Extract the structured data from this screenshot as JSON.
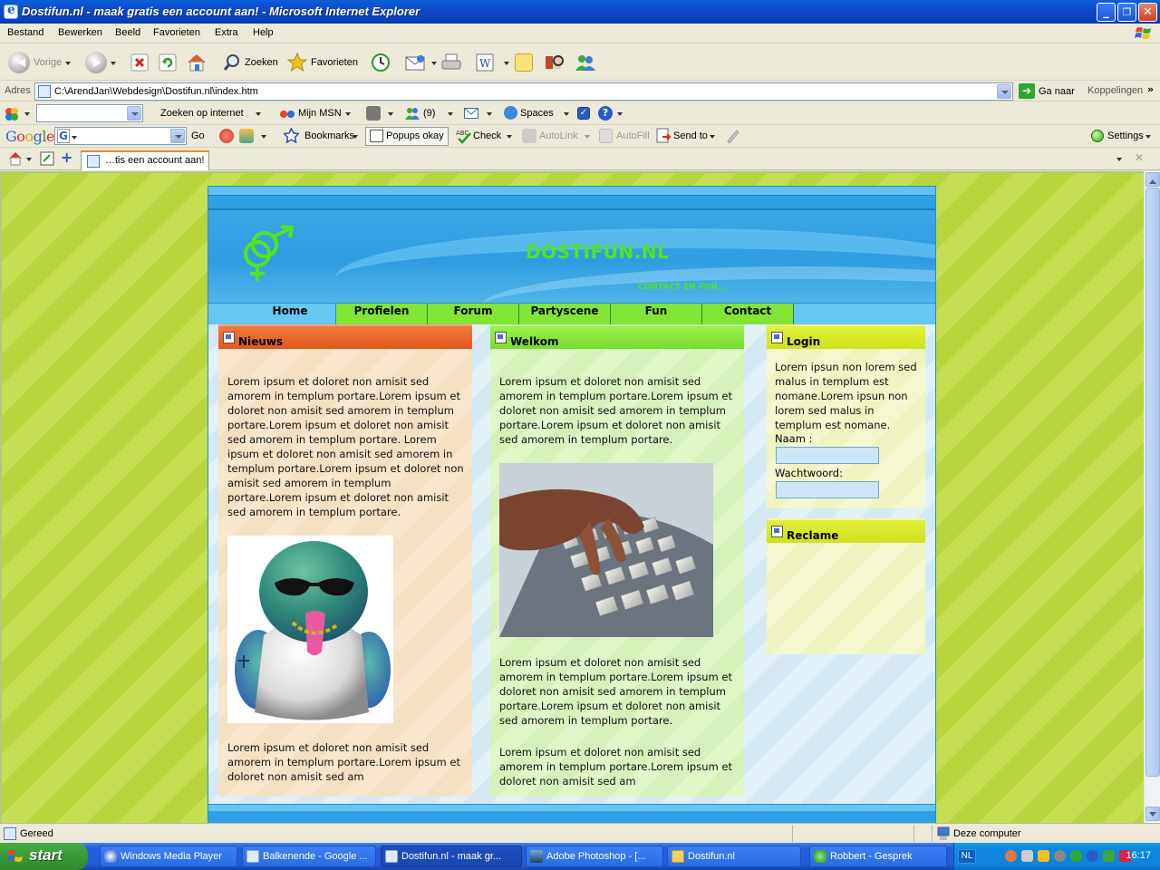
{
  "window": {
    "title": "Dostifun.nl - maak gratis een account aan! - Microsoft Internet Explorer",
    "minimize": "_",
    "maximize": "❐",
    "close": "✕"
  },
  "menu": [
    "Bestand",
    "Bewerken",
    "Beeld",
    "Favorieten",
    "Extra",
    "Help"
  ],
  "toolbar": {
    "back_label": "Vorige",
    "search_label": "Zoeken",
    "favorites_label": "Favorieten"
  },
  "address": {
    "label": "Adres",
    "url": "C:\\ArendJan\\Webdesign\\Dostifun.nl\\index.htm",
    "go_label": "Ga naar",
    "links_label": "Koppelingen"
  },
  "msn_toolbar": {
    "search_value": "",
    "search_web_label": "Zoeken op internet",
    "my_msn_label": "Mijn MSN",
    "messenger_count": "(9)",
    "spaces_label": "Spaces"
  },
  "google_toolbar": {
    "logo_letters": [
      "G",
      "o",
      "o",
      "g",
      "l",
      "e"
    ],
    "search_value": "",
    "go_label": "Go",
    "bookmarks_label": "Bookmarks",
    "popups_label": "Popups okay",
    "check_label": "Check",
    "autolink_label": "AutoLink",
    "autofill_label": "AutoFill",
    "sendto_label": "Send to",
    "settings_label": "Settings"
  },
  "tabs": [
    {
      "label": "…tis een account aan!",
      "active": true
    }
  ],
  "site": {
    "title": "DOSTIFUN.NL",
    "slogan": "CONTACT EN FUN....",
    "nav": [
      "Home",
      "Profielen",
      "Forum",
      "Partyscene",
      "Fun",
      "Contact"
    ],
    "news": {
      "heading": "Nieuws",
      "text1": "Lorem ipsum et doloret non amisit sed amorem in templum portare.Lorem ipsum et doloret non amisit sed amorem in templum portare.Lorem ipsum et doloret non amisit sed amorem in templum portare. Lorem ipsum et doloret non amisit sed amorem in templum portare.Lorem ipsum et doloret non amisit sed amorem in templum portare.Lorem ipsum et doloret non amisit sed amorem in templum portare.",
      "text2": "Lorem ipsum et doloret non amisit sed amorem in templum portare.Lorem ipsum et doloret non amisit sed am"
    },
    "welcome": {
      "heading": "Welkom",
      "text1": "Lorem ipsum et doloret non amisit sed amorem in templum portare.Lorem ipsum et doloret non amisit sed amorem in templum portare.Lorem ipsum et doloret non amisit sed amorem in templum portare.",
      "text2": "Lorem ipsum et doloret non amisit sed amorem in templum portare.Lorem ipsum et doloret non amisit sed amorem in templum portare.Lorem ipsum et doloret non amisit sed amorem in templum portare.",
      "text3": "Lorem ipsum et doloret non amisit sed amorem in templum portare.Lorem ipsum et doloret non amisit sed am"
    },
    "login": {
      "heading": "Login",
      "text": "Lorem ipsun non lorem sed malus in templum est nomane.Lorem ipsun non lorem sed malus in templum est nomane.",
      "name_label": "Naam :",
      "password_label": "Wachtwoord:",
      "name_value": "",
      "password_value": ""
    },
    "ad": {
      "heading": "Reclame"
    }
  },
  "status": {
    "text": "Gereed",
    "zone": "Deze computer"
  },
  "taskbar": {
    "start_label": "start",
    "tasks": [
      "Windows Media Player",
      "Balkenende - Google ...",
      "Dostifun.nl - maak gr...",
      "Adobe Photoshop - [...",
      "Dostifun.nl",
      "Robbert - Gesprek"
    ],
    "lang": "NL",
    "clock": "16:17"
  },
  "colors": {
    "site_title": "#55e31e",
    "nav_green": "#82e536",
    "news_header": "#e2571a",
    "welcome_header": "#78dc2c",
    "login_header": "#cfe21c",
    "page_background": "#c6de52"
  },
  "icons": [
    "back-icon",
    "forward-icon",
    "stop-icon",
    "refresh-icon",
    "home-icon",
    "search-icon",
    "favorites-star-icon",
    "history-icon",
    "mail-icon",
    "print-icon",
    "edit-icon",
    "notes-icon",
    "research-icon",
    "messenger-icon",
    "go-arrow-icon"
  ]
}
